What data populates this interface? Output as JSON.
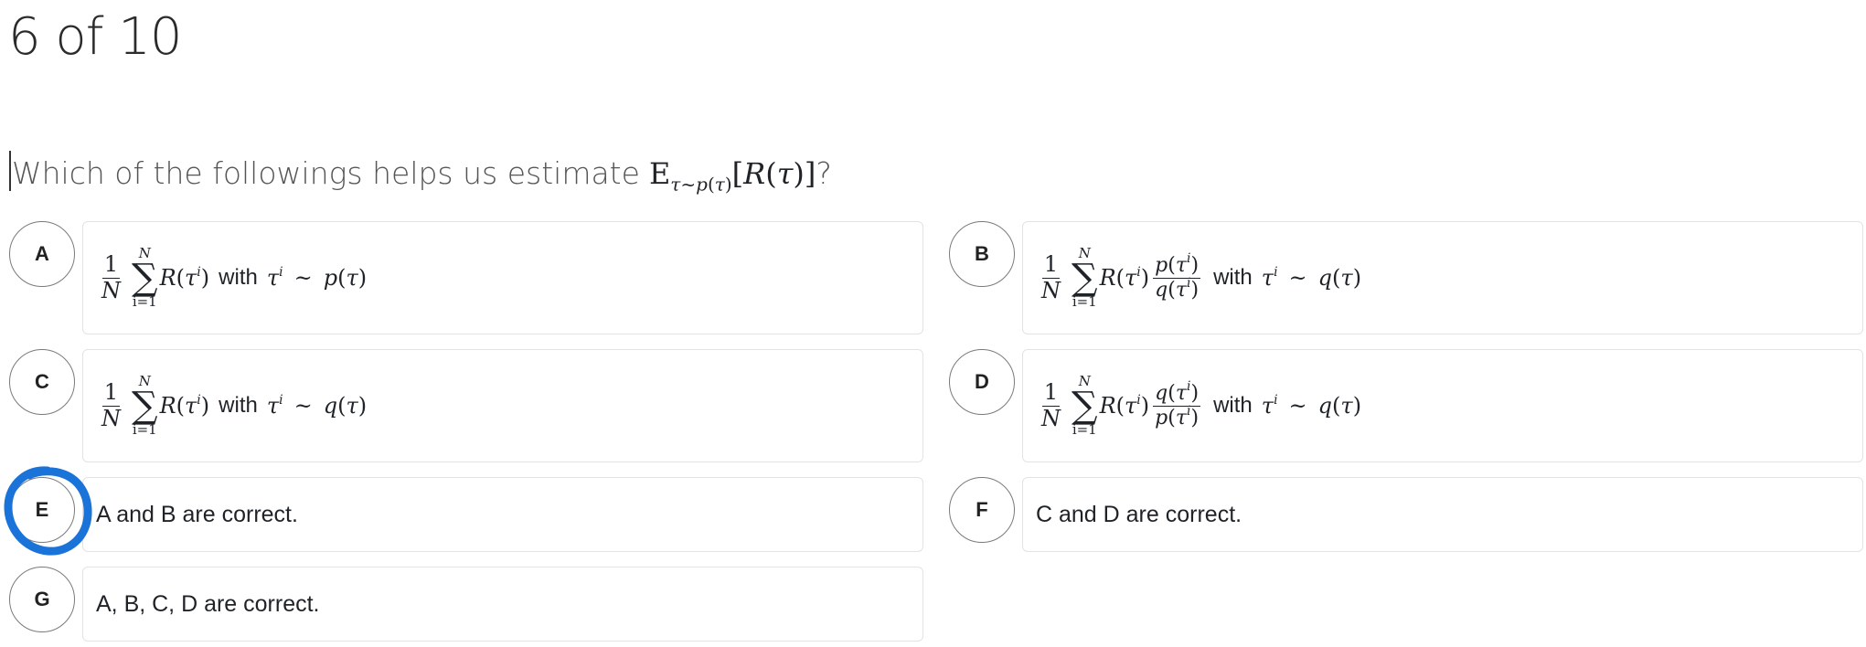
{
  "header": {
    "progress": "6 of 10"
  },
  "question": {
    "text": "Which of the followings helps us estimate",
    "suffix": "?"
  },
  "math": {
    "one": "1",
    "N": "N",
    "sum_upper": "N",
    "sum_lower": "i=1",
    "sigma": "∑",
    "tau": "τ",
    "tilde": "~",
    "i": "i",
    "with": "with"
  },
  "options": [
    {
      "letter": "A",
      "text": ""
    },
    {
      "letter": "B",
      "text": ""
    },
    {
      "letter": "C",
      "text": ""
    },
    {
      "letter": "D",
      "text": ""
    },
    {
      "letter": "E",
      "text": "A and B are correct."
    },
    {
      "letter": "F",
      "text": "C and D are correct."
    },
    {
      "letter": "G",
      "text": "A, B, C, D are correct."
    }
  ],
  "colors": {
    "annotation": "#1a73d9",
    "card_border": "#e3e3e3"
  },
  "icons": {
    "selection_mark": "hand-drawn-circle-icon"
  }
}
